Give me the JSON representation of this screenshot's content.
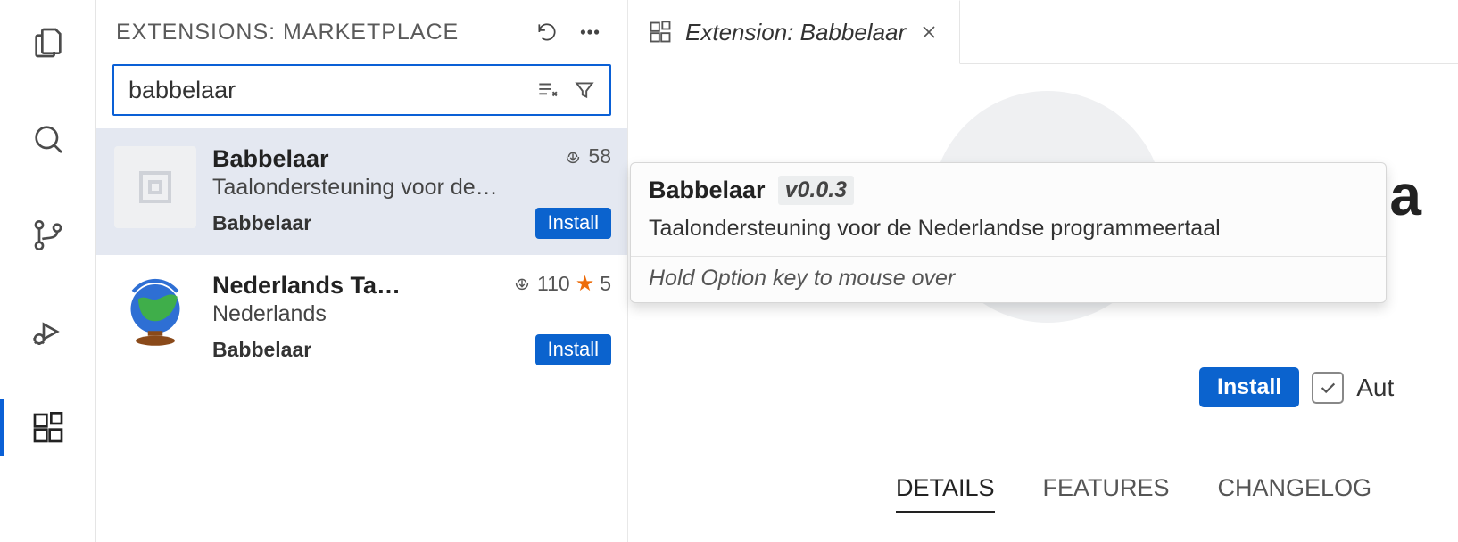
{
  "sidebar": {
    "title": "EXTENSIONS: MARKETPLACE",
    "search_value": "babbelaar"
  },
  "extensions": [
    {
      "name": "Babbelaar",
      "downloads": "58",
      "description": "Taalondersteuning voor de…",
      "publisher": "Babbelaar",
      "install_label": "Install",
      "selected": true
    },
    {
      "name": "Nederlands Ta…",
      "downloads": "110",
      "rating": "5",
      "description": "Nederlands",
      "publisher": "Babbelaar",
      "install_label": "Install",
      "selected": false
    }
  ],
  "editor": {
    "tab_title": "Extension: Babbelaar",
    "big_title": "Babbela",
    "install_label": "Install",
    "auto_label": "Aut",
    "detail_tabs": {
      "details": "DETAILS",
      "features": "FEATURES",
      "changelog": "CHANGELOG"
    }
  },
  "hover": {
    "title": "Babbelaar",
    "version": "v0.0.3",
    "description": "Taalondersteuning voor de Nederlandse programmeertaal",
    "footer": "Hold Option key to mouse over"
  }
}
